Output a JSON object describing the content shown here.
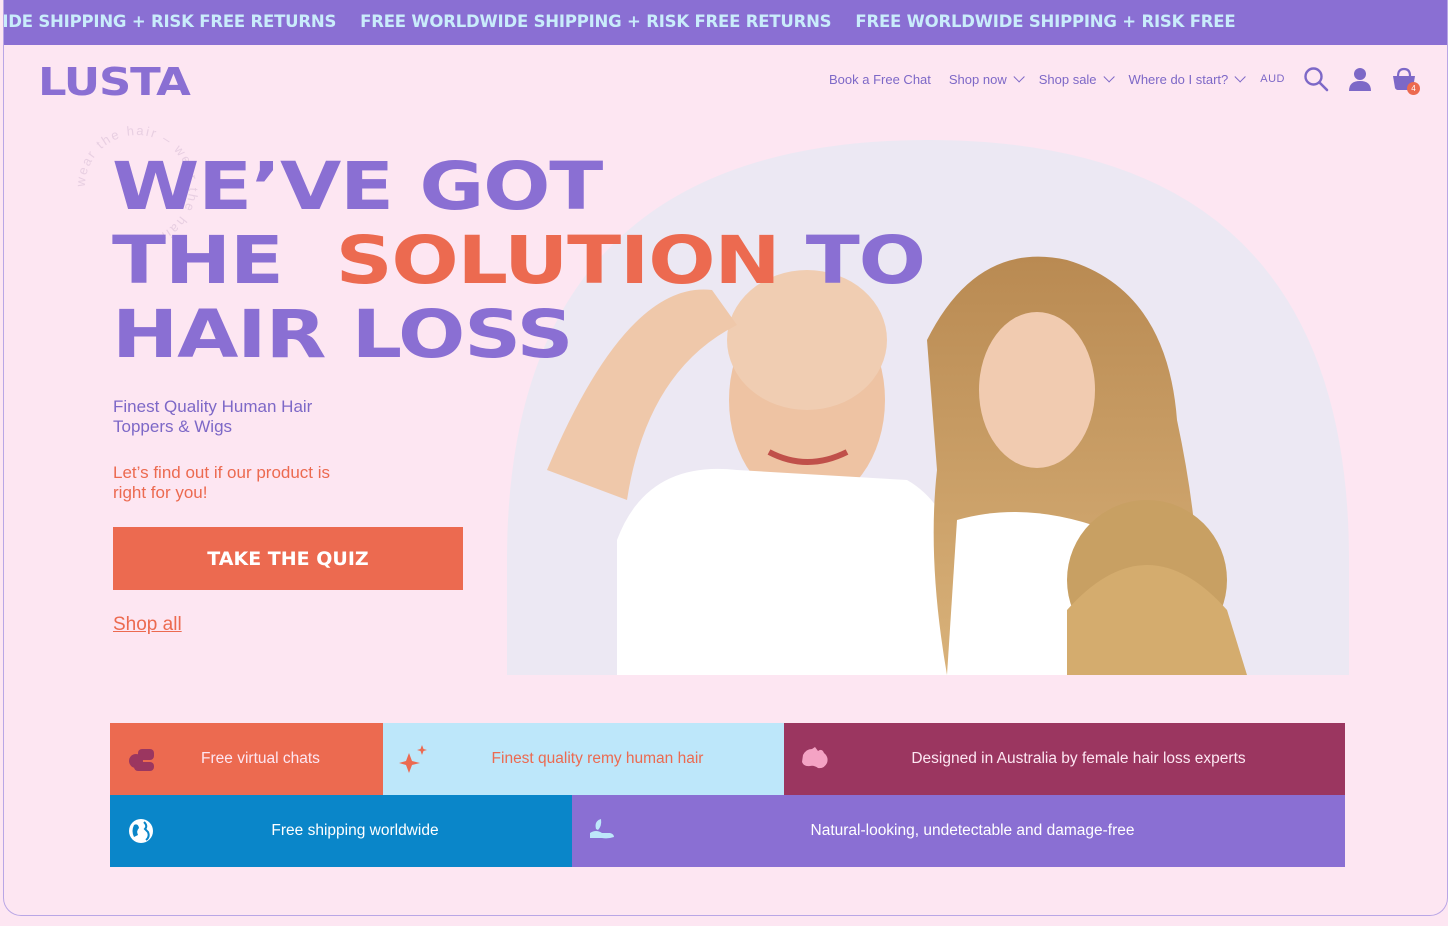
{
  "announcement": {
    "items": [
      "RLDWIDE SHIPPING + RISK FREE RETURNS",
      "FREE WORLDWIDE SHIPPING + RISK FREE RETURNS",
      "FREE WORLDWIDE SHIPPING + RISK FREE"
    ]
  },
  "header": {
    "logo": "LUSTA",
    "nav": {
      "book": "Book a Free Chat",
      "shop_now": "Shop now",
      "shop_sale": "Shop sale",
      "where_start": "Where do I start?",
      "currency": "AUD"
    },
    "cart_count": "4"
  },
  "decor": {
    "circle_text": "wear the hair – wear the hair – "
  },
  "hero": {
    "headline_line1": "WE’VE GOT",
    "headline_line2a": "THE",
    "headline_line2b": "SOLUTION",
    "headline_line2c": "TO",
    "headline_line3": "HAIR LOSS",
    "subtitle": "Finest Quality Human Hair Toppers & Wigs",
    "prompt": "Let’s find out if our product is right for you!",
    "quiz_button": "TAKE THE QUIZ",
    "shop_all": "Shop all"
  },
  "features": [
    {
      "label": "Free virtual chats",
      "icon": "chat-bubbles-icon",
      "bg": "#ec6a50",
      "fg": "#fde6f2"
    },
    {
      "label": "Finest quality remy human hair",
      "icon": "sparkle-stars-icon",
      "bg": "#bde7fa",
      "fg": "#ec6a50"
    },
    {
      "label": "Designed in Australia by female hair loss experts",
      "icon": "australia-map-icon",
      "bg": "#9b3660",
      "fg": "#fde6f2"
    },
    {
      "label": "Free shipping worldwide",
      "icon": "globe-icon",
      "bg": "#0a86c9",
      "fg": "#ffffff"
    },
    {
      "label": "Natural-looking, undetectable and damage-free",
      "icon": "hand-leaf-icon",
      "bg": "#8a6fd3",
      "fg": "#ffffff"
    }
  ],
  "colors": {
    "background": "#fde6f2",
    "purple": "#8a6fd3",
    "coral": "#ec6a50"
  }
}
